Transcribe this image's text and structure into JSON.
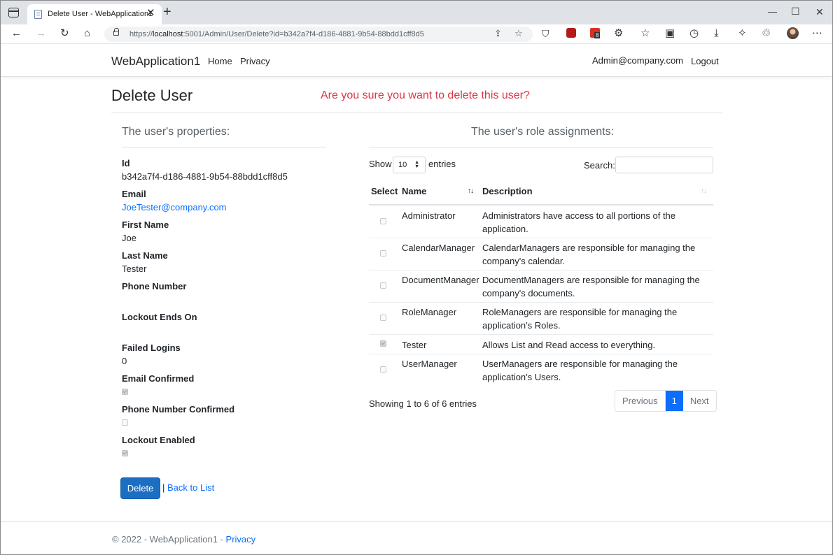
{
  "browser": {
    "tab_title": "Delete User - WebApplication1",
    "url_prefix": "https://",
    "url_host": "localhost",
    "url_rest": ":5001/Admin/User/Delete?id=b342a7f4-d186-4881-9b54-88bdd1cff8d5",
    "extension_badge": "8"
  },
  "navbar": {
    "brand": "WebApplication1",
    "links": [
      "Home",
      "Privacy"
    ],
    "user": "Admin@company.com",
    "logout": "Logout"
  },
  "page": {
    "title": "Delete User",
    "warning": "Are you sure you want to delete this user?"
  },
  "properties": {
    "heading": "The user's properties:",
    "id_label": "Id",
    "id_value": "b342a7f4-d186-4881-9b54-88bdd1cff8d5",
    "email_label": "Email",
    "email_value": "JoeTester@company.com",
    "first_name_label": "First Name",
    "first_name_value": "Joe",
    "last_name_label": "Last Name",
    "last_name_value": "Tester",
    "phone_label": "Phone Number",
    "lockout_ends_label": "Lockout Ends On",
    "failed_logins_label": "Failed Logins",
    "failed_logins_value": "0",
    "email_confirmed_label": "Email Confirmed",
    "email_confirmed": true,
    "phone_confirmed_label": "Phone Number Confirmed",
    "phone_confirmed": false,
    "lockout_enabled_label": "Lockout Enabled",
    "lockout_enabled": true
  },
  "actions": {
    "delete": "Delete",
    "separator": "|",
    "back": "Back to List"
  },
  "roles": {
    "heading": "The user's role assignments:",
    "show_label": "Show",
    "page_length": "10",
    "entries_label": "entries",
    "search_label": "Search:",
    "columns": [
      "Select",
      "Name",
      "Description"
    ],
    "rows": [
      {
        "selected": false,
        "name": "Administrator",
        "desc1": "Administrators have access to all portions of the",
        "desc2": "application."
      },
      {
        "selected": false,
        "name": "CalendarManager",
        "desc1": "CalendarManagers are responsible for managing the",
        "desc2": "company's calendar."
      },
      {
        "selected": false,
        "name": "DocumentManager",
        "desc1": "DocumentManagers are responsible for managing the",
        "desc2": "company's documents."
      },
      {
        "selected": false,
        "name": "RoleManager",
        "desc1": "RoleManagers are responsible for managing the",
        "desc2": "application's Roles."
      },
      {
        "selected": true,
        "name": "Tester",
        "desc1": "Allows List and Read access to everything.",
        "desc2": ""
      },
      {
        "selected": false,
        "name": "UserManager",
        "desc1": "UserManagers are responsible for managing the",
        "desc2": "application's Users."
      }
    ],
    "info": "Showing 1 to 6 of 6 entries",
    "pager": {
      "previous": "Previous",
      "current": "1",
      "next": "Next"
    }
  },
  "footer": {
    "text": "© 2022 - WebApplication1 - ",
    "link": "Privacy"
  },
  "colors": {
    "warning": "#dc3545",
    "link": "#0d6efd",
    "primary_button": "#1b6ec2"
  }
}
